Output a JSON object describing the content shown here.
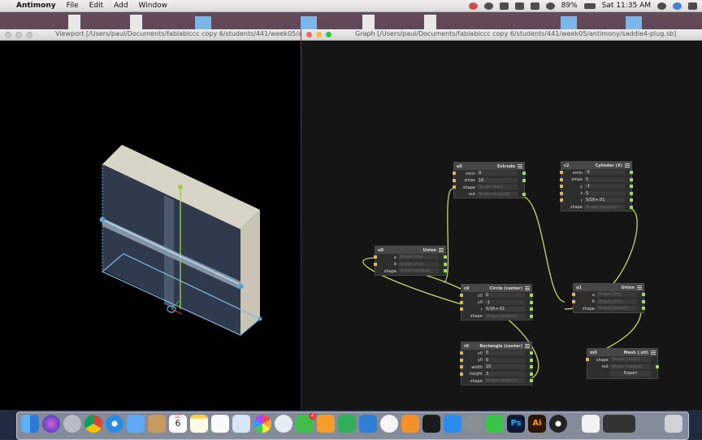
{
  "menubar": {
    "apple_glyph": "",
    "app_name": "Antimony",
    "menus": [
      "File",
      "Edit",
      "Add",
      "Window"
    ],
    "battery": "89%",
    "clock": "Sat 11:35 AM"
  },
  "viewport_window": {
    "title": "Viewport [/Users/paul/Documents/fablablccc copy 6/students/441/week05/antimony/saddle4-plug.sb]"
  },
  "graph_window": {
    "title": "Graph [/Users/paul/Documents/fablablccc copy 6/students/441/week05/antimony/saddle4-plug.sb]"
  },
  "nodes": {
    "e0": {
      "id": "e0",
      "type": "Extrude",
      "rows": [
        {
          "label": "zmin",
          "value": "0"
        },
        {
          "label": "zmax",
          "value": "10"
        },
        {
          "label": "shape",
          "value": "Shape [bas]"
        },
        {
          "label": "out",
          "value": "Shape [output]"
        }
      ]
    },
    "c2": {
      "id": "c2",
      "type": "Cylinder (X)",
      "rows": [
        {
          "label": "xmin",
          "value": "-5"
        },
        {
          "label": "xmax",
          "value": "5"
        },
        {
          "label": "y",
          "value": "-1"
        },
        {
          "label": "z",
          "value": "5"
        },
        {
          "label": "r",
          "value": "5/16+.01"
        },
        {
          "label": "shape",
          "value": "Shape [output]"
        }
      ]
    },
    "u0": {
      "id": "u0",
      "type": "Union",
      "rows": [
        {
          "label": "a",
          "value": "Shape [lhs]"
        },
        {
          "label": "b",
          "value": "Shape [rhs]"
        },
        {
          "label": "shape",
          "value": "Shape [output]"
        }
      ]
    },
    "c0": {
      "id": "c0",
      "type": "Circle (center)",
      "rows": [
        {
          "label": "x0",
          "value": "0"
        },
        {
          "label": "y0",
          "value": "-1"
        },
        {
          "label": "r",
          "value": "5/16+.01"
        },
        {
          "label": "shape",
          "value": "Shape [output]"
        }
      ]
    },
    "u1": {
      "id": "u1",
      "type": "Union",
      "rows": [
        {
          "label": "a",
          "value": "Shape [lhs]"
        },
        {
          "label": "b",
          "value": "Shape [rhs]"
        },
        {
          "label": "shape",
          "value": "Shape [output]"
        }
      ]
    },
    "r0": {
      "id": "r0",
      "type": "Rectangle (center)",
      "rows": [
        {
          "label": "x0",
          "value": "0"
        },
        {
          "label": "y0",
          "value": "0"
        },
        {
          "label": "width",
          "value": "10"
        },
        {
          "label": "height",
          "value": "3"
        },
        {
          "label": "shape",
          "value": "Shape [output]"
        }
      ]
    },
    "m0": {
      "id": "m0",
      "type": "Mesh (.stl)",
      "rows": [
        {
          "label": "shape",
          "value": "Shape [input]"
        },
        {
          "label": "out",
          "value": "Shape [output]"
        }
      ],
      "button": "Export"
    }
  },
  "dock": {
    "calendar_month": "DEC",
    "calendar_day": "6",
    "messages_badge": "4",
    "photoshop_label": "Ps",
    "illustrator_label": "Ai"
  },
  "colors": {
    "wire": "#c9d66a",
    "input_port": "#d6b85c",
    "output_port": "#a7d660",
    "node_body": "#2e2e2e",
    "node_header": "#474747",
    "graph_bg": "#151515",
    "model_face": "#2f3b4c",
    "model_top": "#d8d4c8",
    "control_lines": "#7fb8e0"
  }
}
